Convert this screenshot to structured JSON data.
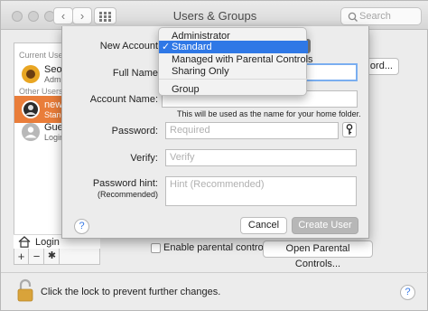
{
  "window": {
    "title": "Users & Groups"
  },
  "toolbar": {
    "back": "‹",
    "forward": "›",
    "search_placeholder": "Search"
  },
  "sidebar": {
    "current_users_header": "Current User",
    "current_user": {
      "name": "Seong",
      "role": "Admin"
    },
    "other_users_header": "Other Users",
    "other_users": [
      {
        "name": "newu",
        "role": "Stand"
      },
      {
        "name": "Gues",
        "role": "Login"
      }
    ],
    "login_options": "Login",
    "add": "+",
    "remove": "−",
    "gear": "✱"
  },
  "background": {
    "change_password_button": "ord...",
    "enable_parental_controls": "Enable parental controls",
    "open_parental_controls": "Open Parental Controls..."
  },
  "sheet": {
    "new_account_label": "New Account",
    "full_name_label": "Full Name",
    "full_name_value": "",
    "account_name_label": "Account Name:",
    "account_name_value": "",
    "account_name_hint": "This will be used as the name for your home folder.",
    "password_label": "Password:",
    "password_placeholder": "Required",
    "verify_label": "Verify:",
    "verify_placeholder": "Verify",
    "password_hint_label": "Password hint:",
    "password_hint_sublabel": "(Recommended)",
    "password_hint_placeholder": "Hint (Recommended)",
    "help": "?",
    "cancel": "Cancel",
    "create_user": "Create User"
  },
  "menu": {
    "items": [
      {
        "label": "Administrator",
        "selected": false
      },
      {
        "label": "Standard",
        "selected": true
      },
      {
        "label": "Managed with Parental Controls",
        "selected": false
      },
      {
        "label": "Sharing Only",
        "selected": false
      },
      {
        "label": "Group",
        "selected": false
      }
    ],
    "checkmark": "✓"
  },
  "footer": {
    "lock_text": "Click the lock to prevent further changes.",
    "help": "?"
  },
  "colors": {
    "selection_orange": "#e97d3a",
    "menu_highlight": "#2f78e6",
    "focus_ring": "#7aaef0"
  }
}
